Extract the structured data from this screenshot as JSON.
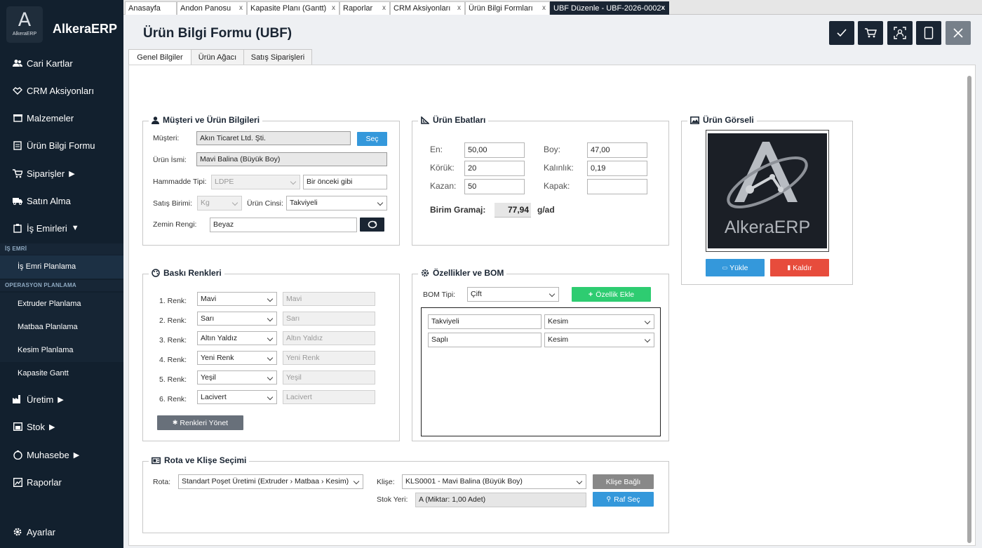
{
  "app": {
    "name": "AlkeraERP",
    "logo_text": "AlkeraERP"
  },
  "sidebar": {
    "items": [
      {
        "label": "Cari Kartlar",
        "icon": "users-icon"
      },
      {
        "label": "CRM Aksiyonları",
        "icon": "handshake-icon"
      },
      {
        "label": "Malzemeler",
        "icon": "box-icon"
      },
      {
        "label": "Ürün Bilgi Formu",
        "icon": "document-icon"
      },
      {
        "label": "Siparişler",
        "icon": "cart-icon",
        "arrow": "▶"
      },
      {
        "label": "Satın Alma",
        "icon": "truck-icon"
      },
      {
        "label": "İş Emirleri",
        "icon": "clipboard-icon",
        "arrow": "▼"
      }
    ],
    "section_is_emri": "İŞ EMRİ",
    "sub_is_emri": [
      "İş Emri Planlama"
    ],
    "section_operasyon": "OPERASYON PLANLAMA",
    "sub_operasyon": [
      "Extruder Planlama",
      "Matbaa Planlama",
      "Kesim Planlama"
    ],
    "sub_extra": "Kapasite Gantt",
    "bottom_items": [
      {
        "label": "Üretim",
        "icon": "factory-icon",
        "arrow": "▶"
      },
      {
        "label": "Stok",
        "icon": "warehouse-icon",
        "arrow": "▶"
      },
      {
        "label": "Muhasebe",
        "icon": "money-icon",
        "arrow": "▶"
      },
      {
        "label": "Raporlar",
        "icon": "chart-icon"
      }
    ],
    "settings": {
      "label": "Ayarlar",
      "icon": "gear-icon"
    }
  },
  "doc_tabs": [
    {
      "label": "Anasayfa",
      "closable": false
    },
    {
      "label": "Andon Panosu",
      "closable": true
    },
    {
      "label": "Kapasite Planı (Gantt)",
      "closable": true
    },
    {
      "label": "Raporlar",
      "closable": true
    },
    {
      "label": "CRM Aksiyonları",
      "closable": true
    },
    {
      "label": "Ürün Bilgi Formları",
      "closable": true
    },
    {
      "label": "UBF Düzenle - UBF-2026-0002",
      "closable": true,
      "active": true
    }
  ],
  "close_symbol": "x",
  "header": {
    "title": "Ürün Bilgi Formu (UBF)"
  },
  "form_tabs": [
    "Genel Bilgiler",
    "Ürün Ağacı",
    "Satış Siparişleri"
  ],
  "musteri": {
    "title": "Müşteri ve Ürün Bilgileri",
    "musteri_label": "Müşteri:",
    "musteri_value": "Akın Ticaret Ltd. Şti.",
    "sec_button": "Seç",
    "urun_label": "Ürün İsmi:",
    "urun_value": "Mavi Balina (Büyük Boy)",
    "hammadde_label": "Hammadde Tipi:",
    "hammadde_value": "LDPE",
    "hammadde_note": "Bir önceki gibi",
    "satis_label": "Satış Birimi:",
    "satis_value": "Kg",
    "cinsi_label": "Ürün Cinsi:",
    "cinsi_value": "Takviyeli",
    "zemin_label": "Zemin Rengi:",
    "zemin_value": "Beyaz"
  },
  "ebat": {
    "title": "Ürün Ebatları",
    "en_label": "En:",
    "en_value": "50,00",
    "boy_label": "Boy:",
    "boy_value": "47,00",
    "koruk_label": "Körük:",
    "koruk_value": "20",
    "kalinlik_label": "Kalınlık:",
    "kalinlik_value": "0,19",
    "kazan_label": "Kazan:",
    "kazan_value": "50",
    "kapak_label": "Kapak:",
    "kapak_value": "",
    "gram_label": "Birim Gramaj:",
    "gram_value": "77,94",
    "gram_unit": "g/ad"
  },
  "gorsel": {
    "title": "Ürün Görseli",
    "logo_text": "AlkeraERP",
    "upload": "Yükle",
    "remove": "Kaldır"
  },
  "renkler": {
    "title": "Baskı Renkleri",
    "rows": [
      {
        "label": "1. Renk:",
        "value": "Mavi",
        "name": "Mavi"
      },
      {
        "label": "2. Renk:",
        "value": "Sarı",
        "name": "Sarı"
      },
      {
        "label": "3. Renk:",
        "value": "Altın Yaldız",
        "name": "Altın Yaldız"
      },
      {
        "label": "4. Renk:",
        "value": "Yeni Renk",
        "name": "Yeni Renk"
      },
      {
        "label": "5. Renk:",
        "value": "Yeşil",
        "name": "Yeşil"
      },
      {
        "label": "6. Renk:",
        "value": "Lacivert",
        "name": "Lacivert"
      }
    ],
    "manage": "Renkleri Yönet"
  },
  "bom": {
    "title": "Özellikler ve BOM",
    "tip_label": "BOM Tipi:",
    "tip_value": "Çift",
    "add_button": "Özellik Ekle",
    "rows": [
      {
        "name": "Takviyeli",
        "process": "Kesim"
      },
      {
        "name": "Saplı",
        "process": "Kesim"
      }
    ]
  },
  "rota": {
    "title": "Rota ve Klişe Seçimi",
    "rota_label": "Rota:",
    "rota_value": "Standart Poşet Üretimi  (Extruder › Matbaa › Kesim)",
    "klise_label": "Klişe:",
    "klise_value": "KLS0001 - Mavi Balina (Büyük Boy)",
    "klise_button": "Klişe Bağlı",
    "stok_label": "Stok Yeri:",
    "stok_value": "A (Miktar: 1,00 Adet)",
    "raf_button": "Raf Seç"
  },
  "colors": {
    "sidebar": "#12202e",
    "dark": "#1a2533",
    "blue": "#3498db",
    "red": "#e74c3c",
    "green": "#2ecc71"
  }
}
